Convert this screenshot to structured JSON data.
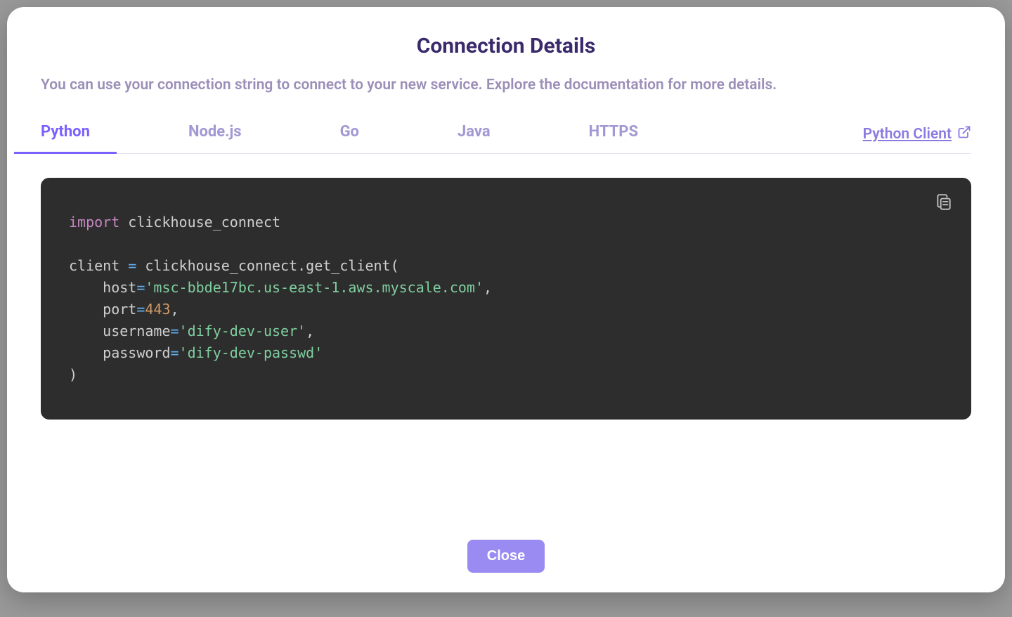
{
  "modal": {
    "title": "Connection Details",
    "subtitle": "You can use your connection string to connect to your new service. Explore the documentation for more details.",
    "tabs": [
      {
        "label": "Python",
        "active": true
      },
      {
        "label": "Node.js",
        "active": false
      },
      {
        "label": "Go",
        "active": false
      },
      {
        "label": "Java",
        "active": false
      },
      {
        "label": "HTTPS",
        "active": false
      }
    ],
    "doc_link_label": "Python Client",
    "close_label": "Close"
  },
  "code": {
    "kw_import": "import",
    "module": "clickhouse_connect",
    "line3_a": "client ",
    "op_eq": "=",
    "line3_b": " clickhouse_connect.get_client(",
    "param_host": "    host",
    "val_host": "'msc-bbde17bc.us-east-1.aws.myscale.com'",
    "comma": ",",
    "param_port": "    port",
    "val_port": "443",
    "param_user": "    username",
    "val_user": "'dify-dev-user'",
    "param_pass": "    password",
    "val_pass": "'dify-dev-passwd'",
    "close_paren": ")"
  }
}
